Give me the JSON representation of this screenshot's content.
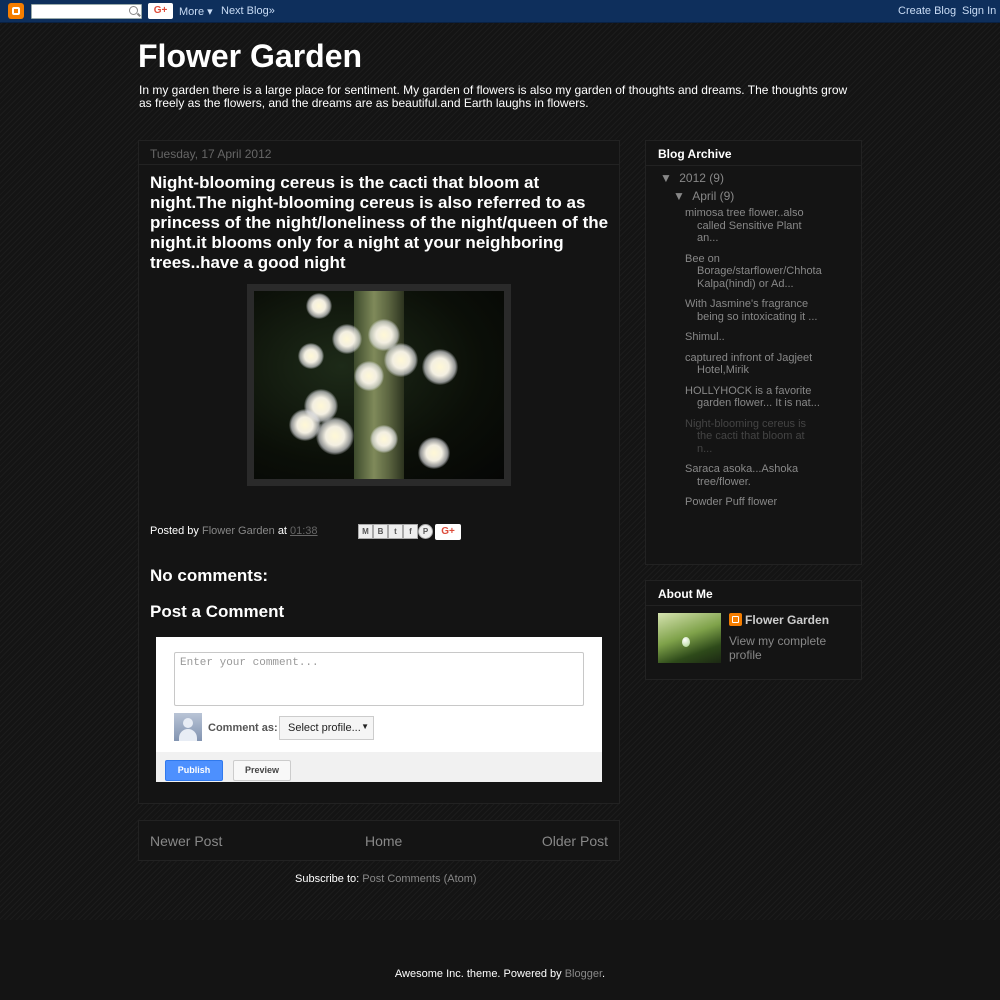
{
  "navbar": {
    "more_label": "More ▾",
    "next_blog_label": "Next Blog»",
    "create_blog_label": "Create Blog",
    "sign_in_label": "Sign In",
    "gplus_label": "G+"
  },
  "blog": {
    "title": "Flower Garden",
    "description": "In my garden there is a large place for sentiment. My garden of flowers is also my garden of thoughts and dreams. The thoughts grow as freely as the flowers, and the dreams are as beautiful.and Earth laughs in flowers."
  },
  "post": {
    "date": "Tuesday, 17 April 2012",
    "title": "Night-blooming cereus is the cacti that bloom at night.The night-blooming cereus is also referred to as princess of the night/loneliness of the night/queen of the night.it blooms only for a night at your neighboring trees..have a good night",
    "posted_by_label": "Posted by",
    "author": "Flower Garden",
    "at_label": "at",
    "time": "01:38",
    "share_gplus": "G+"
  },
  "comments": {
    "no_comments": "No comments:",
    "post_a_comment": "Post a Comment",
    "placeholder": "Enter your comment...",
    "comment_as_label": "Comment as:",
    "profile_select": "Select profile...",
    "publish_label": "Publish",
    "preview_label": "Preview"
  },
  "pager": {
    "newer": "Newer Post",
    "home": "Home",
    "older": "Older Post"
  },
  "subscribe": {
    "label": "Subscribe to:",
    "link": "Post Comments (Atom)"
  },
  "archive": {
    "title": "Blog Archive",
    "year_arrow": "▼",
    "year": "2012",
    "year_count": "(9)",
    "month_arrow": "▼",
    "month": "April",
    "month_count": "(9)",
    "posts": [
      "mimosa tree flower..also called Sensitive Plant an...",
      "Bee on Borage/starflower/Chhota Kalpa(hindi) or Ad...",
      "With Jasmine's fragrance being so intoxicating it ...",
      "Shimul..",
      "captured infront of Jagjeet Hotel,Mirik",
      "HOLLYHOCK is a favorite garden flower... It is nat...",
      "Night-blooming cereus is the cacti that bloom at n...",
      "Saraca asoka...Ashoka tree/flower.",
      "Powder Puff flower"
    ]
  },
  "about": {
    "title": "About Me",
    "name": "Flower Garden",
    "view_profile": "View my complete profile"
  },
  "footer": {
    "text": "Awesome Inc. theme. Powered by",
    "link": "Blogger",
    "end": "."
  }
}
